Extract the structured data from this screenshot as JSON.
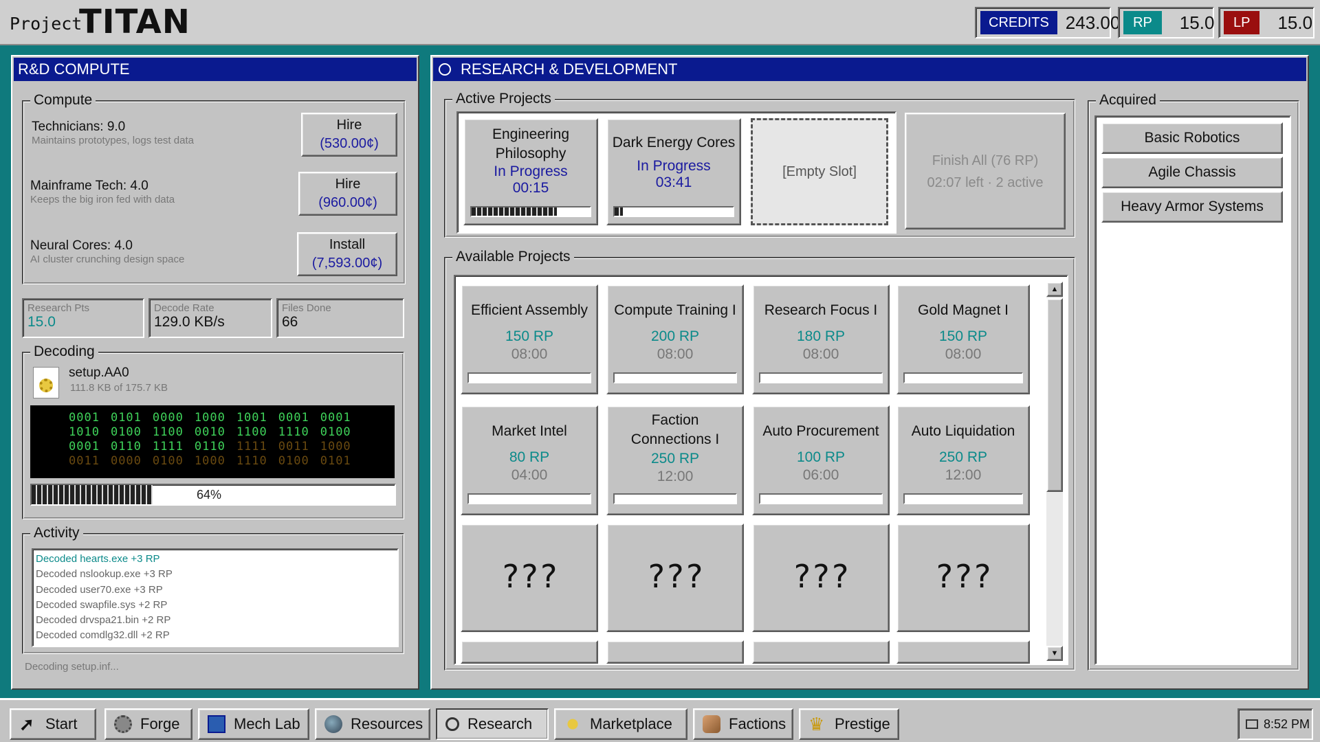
{
  "header": {
    "brand_small": "Project",
    "brand_big": "TITAN",
    "resources": [
      {
        "label": "CREDITS",
        "value": "243.00",
        "color": "#0a1a8f"
      },
      {
        "label": "RP",
        "value": "15.0",
        "color": "#0b8a8a"
      },
      {
        "label": "LP",
        "value": "15.0",
        "color": "#9a0e0e"
      }
    ]
  },
  "compute_window": {
    "title": "R&D COMPUTE",
    "compute_group": "Compute",
    "rows": [
      {
        "name": "Technicians: 9.0",
        "desc": "Maintains prototypes, logs test data",
        "button": "Hire",
        "cost": "(530.00¢)"
      },
      {
        "name": "Mainframe Tech: 4.0",
        "desc": "Keeps the big iron fed with data",
        "button": "Hire",
        "cost": "(960.00¢)"
      },
      {
        "name": "Neural Cores: 4.0",
        "desc": "AI cluster crunching design space",
        "button": "Install",
        "cost": "(7,593.00¢)"
      }
    ],
    "stats": [
      {
        "label": "Research Pts",
        "value": "15.0"
      },
      {
        "label": "Decode Rate",
        "value": "129.0 KB/s"
      },
      {
        "label": "Files Done",
        "value": "66"
      }
    ],
    "decoding": {
      "group": "Decoding",
      "file": "setup.AA0",
      "size": "111.8 KB of 175.7 KB",
      "matrix": [
        [
          "0001",
          "0101",
          "0000",
          "1000",
          "1001",
          "0001",
          "0001"
        ],
        [
          "1010",
          "0100",
          "1100",
          "0010",
          "1100",
          "1110",
          "0100"
        ],
        [
          "0001",
          "0110",
          "1111",
          "0110",
          "1111",
          "0011",
          "1000"
        ],
        [
          "0011",
          "0000",
          "0100",
          "1000",
          "1110",
          "0100",
          "0101"
        ]
      ],
      "progress_label": "64%",
      "progress": 0.64
    },
    "activity": {
      "group": "Activity",
      "items": [
        "Decoded  hearts.exe  +3 RP",
        "Decoded  nslookup.exe  +3 RP",
        "Decoded  user70.exe  +3 RP",
        "Decoded  swapfile.sys  +2 RP",
        "Decoded  drvspa21.bin  +2 RP",
        "Decoded  comdlg32.dll  +2 RP"
      ]
    },
    "footer": "Decoding setup.inf..."
  },
  "research_window": {
    "title": "RESEARCH & DEVELOPMENT",
    "active_group": "Active Projects",
    "active": [
      {
        "name": "Engineering Philosophy",
        "status": "In Progress",
        "time": "00:15",
        "progress": 0.72
      },
      {
        "name": "Dark Energy Cores",
        "status": "In Progress",
        "time": "03:41",
        "progress": 0.07
      }
    ],
    "empty_slot": "[Empty  Slot]",
    "finish_all": {
      "line1": "Finish All (76 RP)",
      "line2": "02:07 left · 2 active"
    },
    "available_group": "Available Projects",
    "available": [
      {
        "name": "Efficient Assembly",
        "rp": "150 RP",
        "time": "08:00"
      },
      {
        "name": "Compute Training I",
        "rp": "200 RP",
        "time": "08:00"
      },
      {
        "name": "Research Focus I",
        "rp": "180 RP",
        "time": "08:00"
      },
      {
        "name": "Gold Magnet I",
        "rp": "150 RP",
        "time": "08:00"
      },
      {
        "name": "Market Intel",
        "rp": "80 RP",
        "time": "04:00"
      },
      {
        "name": "Faction Connections I",
        "rp": "250 RP",
        "time": "12:00"
      },
      {
        "name": "Auto Procurement",
        "rp": "100 RP",
        "time": "06:00"
      },
      {
        "name": "Auto Liquidation",
        "rp": "250 RP",
        "time": "12:00"
      }
    ],
    "locked": [
      "???",
      "???",
      "???",
      "???"
    ],
    "acquired_group": "Acquired",
    "acquired": [
      "Basic Robotics",
      "Agile Chassis",
      "Heavy Armor Systems"
    ]
  },
  "taskbar": {
    "start": "Start",
    "items": [
      "Forge",
      "Mech Lab",
      "Resources",
      "Research",
      "Marketplace",
      "Factions",
      "Prestige"
    ],
    "active": "Research",
    "clock": "8:52 PM"
  }
}
